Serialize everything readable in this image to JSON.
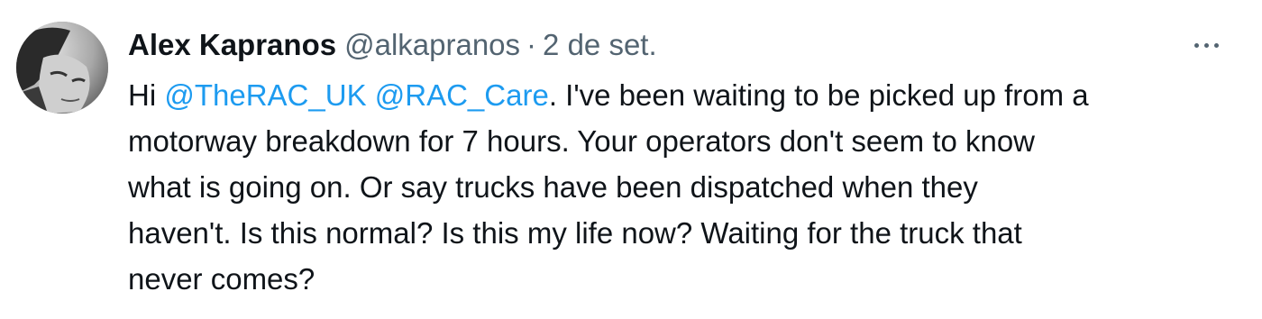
{
  "tweet": {
    "author_name": "Alex Kapranos",
    "handle": "@alkapranos",
    "separator": "·",
    "date": "2 de set.",
    "text_prefix": "Hi ",
    "mentions": [
      "@TheRAC_UK",
      "@RAC_Care"
    ],
    "text_rest": ". I've been waiting to be picked up from a\nmotorway breakdown for 7 hours. Your operators don't seem to know\nwhat is going on. Or say trucks have been dispatched when they\nhaven't. Is this normal? Is this my life now? Waiting for the truck that\nnever comes?"
  },
  "icons": {
    "avatar": "profile-photo",
    "more": "more-options-icon"
  },
  "colors": {
    "text": "#0f1419",
    "secondary": "#536471",
    "link": "#1d9bf0"
  }
}
